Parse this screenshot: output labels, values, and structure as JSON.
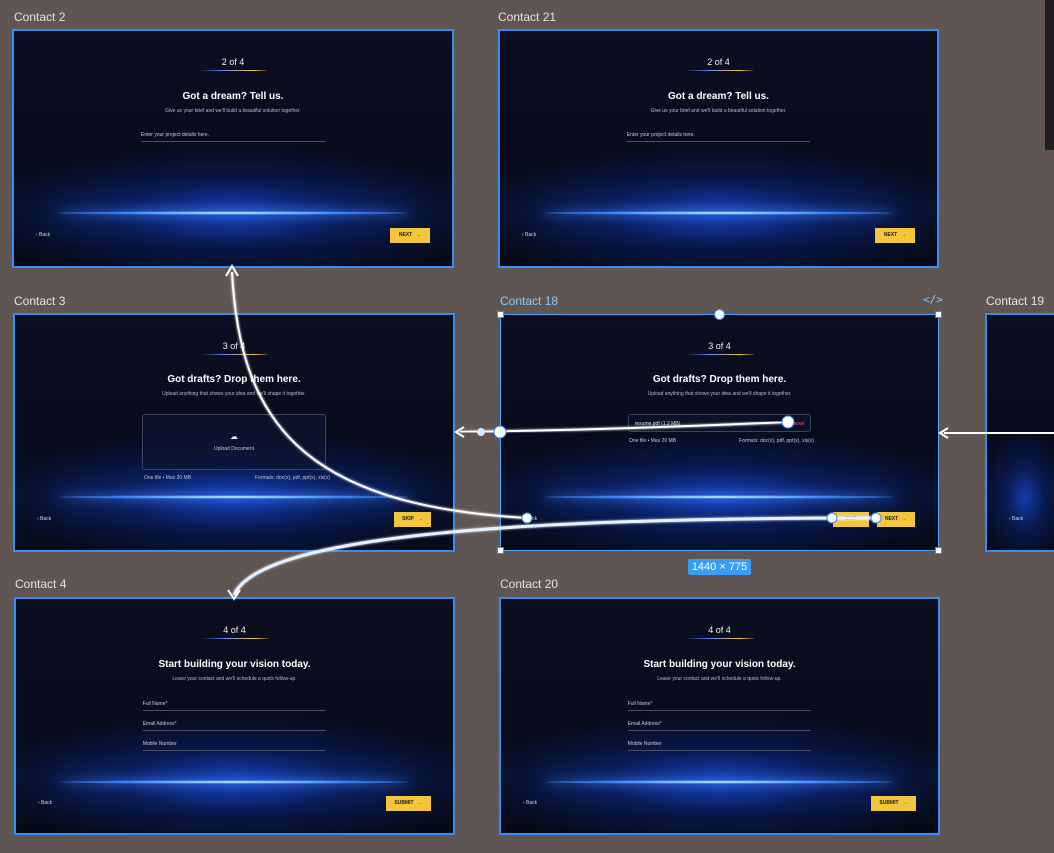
{
  "canvas": {
    "background_color": "#5f5654",
    "selection_color": "#3b8cf0",
    "accent_color": "#f3c63b",
    "selection_size": "1440 × 775",
    "code_icon": "code-icon"
  },
  "frames": {
    "contact2": {
      "label": "Contact 2",
      "step": "2 of 4",
      "title": "Got a dream? Tell us.",
      "subtitle": "Give us your brief and we'll build a beautiful solution together.",
      "project_placeholder": "Enter your project details here.",
      "back": "‹ Back",
      "button": "NEXT"
    },
    "contact21": {
      "label": "Contact 21",
      "step": "2 of 4",
      "title": "Got a dream? Tell us.",
      "subtitle": "Give us your brief and we'll build a beautiful solution together.",
      "project_placeholder": "Enter your project details here.",
      "back": "‹ Back",
      "button": "NEXT"
    },
    "contact3": {
      "label": "Contact 3",
      "step": "3 of 4",
      "title": "Got drafts? Drop them here.",
      "subtitle": "Upload anything that shows your idea and we'll shape it together.",
      "upload_label": "Upload Document",
      "file_limit": "One file • Max 20 MB",
      "formats": "Formats: doc(x), pdf, ppt(x), xls(x)",
      "back": "‹ Back",
      "button": "SKIP"
    },
    "contact18": {
      "label": "Contact 18",
      "step": "3 of 4",
      "title": "Got drafts? Drop them here.",
      "subtitle": "Upload anything that shows your idea and we'll shape it together.",
      "file_name": "resume.pdf (1.2 MB)",
      "remove": "Remove",
      "file_limit": "One file • Max 20 MB",
      "formats": "Formats: doc(x), pdf, ppt(x), xls(x)",
      "back": "‹ Back",
      "skip": "SKIP",
      "button": "NEXT"
    },
    "contact19": {
      "label": "Contact 19",
      "back": "‹ Back"
    },
    "contact4": {
      "label": "Contact 4",
      "step": "4 of 4",
      "title": "Start building your vision today.",
      "subtitle": "Leave your contact and we'll schedule a quick follow-up.",
      "full_name": "Full Name*",
      "email": "Email Address*",
      "mobile": "Mobile Number",
      "back": "‹ Back",
      "button": "SUBMIT"
    },
    "contact20": {
      "label": "Contact 20",
      "step": "4 of 4",
      "title": "Start building your vision today.",
      "subtitle": "Leave your contact and we'll schedule a quick follow-up.",
      "full_name": "Full Name*",
      "email": "Email Address*",
      "mobile": "Mobile Number",
      "back": "‹ Back",
      "button": "SUBMIT"
    }
  }
}
